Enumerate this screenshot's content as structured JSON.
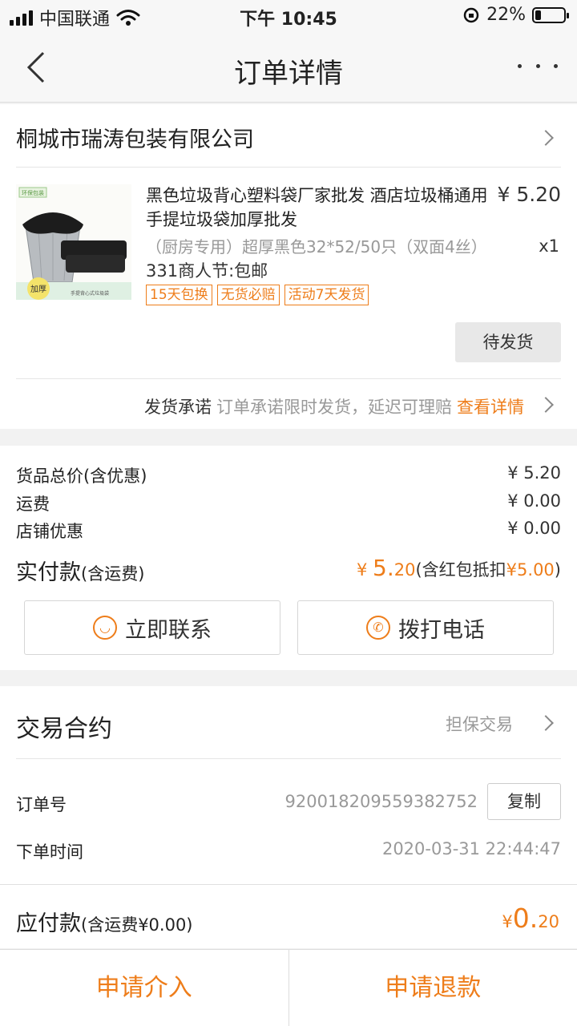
{
  "status_bar": {
    "carrier": "中国联通",
    "time": "下午 10:45",
    "battery": "22%",
    "battery_level": 0.22
  },
  "nav": {
    "title": "订单详情"
  },
  "shop": {
    "name": "桐城市瑞涛包装有限公司"
  },
  "product": {
    "image_labels": [
      "环保包装",
      "加厚",
      "手提背心式垃圾袋"
    ],
    "title": "黑色垃圾背心塑料袋厂家批发 酒店垃圾桶通用手提垃圾袋加厚批发",
    "price": "¥ 5.20",
    "spec": "（厨房专用）超厚黑色32*52/50只（双面4丝）",
    "quantity": "x1",
    "promo": "331商人节:包邮",
    "tags": [
      "15天包换",
      "无货必赔",
      "活动7天发货"
    ],
    "status_button": "待发货"
  },
  "promise": {
    "label": "发货承诺",
    "text": "订单承诺限时发货，延迟可理赔",
    "link": "查看详情"
  },
  "summary": {
    "rows": [
      {
        "label": "货品总价(含优惠)",
        "value": "¥ 5.20"
      },
      {
        "label": "运费",
        "value": "¥ 0.00"
      },
      {
        "label": "店铺优惠",
        "value": "¥ 0.00"
      }
    ],
    "paid_label": "实付款",
    "paid_label_note": "(含运费)",
    "paid_currency": "¥",
    "paid_int": "5.",
    "paid_dec": "20",
    "paid_note_prefix": "(含红包抵扣",
    "paid_note_amount": "¥5.00",
    "paid_note_suffix": ")"
  },
  "actions": {
    "contact": "立即联系",
    "call": "拨打电话"
  },
  "contract": {
    "title": "交易合约",
    "type": "担保交易",
    "order_no_label": "订单号",
    "order_no": "920018209559382752",
    "copy": "复制",
    "order_time_label": "下单时间",
    "order_time": "2020-03-31 22:44:47"
  },
  "due": {
    "label": "应付款",
    "note": "(含运费¥0.00)",
    "currency": "¥",
    "amount_int": "0.",
    "amount_dec": "20"
  },
  "bottom": {
    "intervene": "申请介入",
    "refund": "申请退款"
  },
  "colors": {
    "accent": "#ee7d1a",
    "background": "#f2f2f2"
  }
}
